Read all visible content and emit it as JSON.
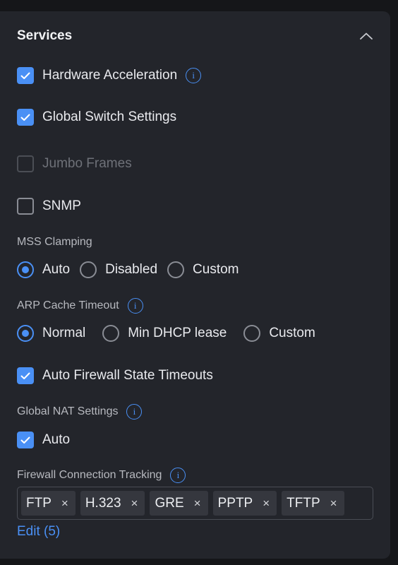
{
  "section": {
    "title": "Services"
  },
  "hardware_acceleration": {
    "label": "Hardware Acceleration"
  },
  "global_switch": {
    "label": "Global Switch Settings"
  },
  "jumbo_frames": {
    "label": "Jumbo Frames"
  },
  "snmp": {
    "label": "SNMP"
  },
  "mss_clamping": {
    "label": "MSS Clamping",
    "options": [
      "Auto",
      "Disabled",
      "Custom"
    ],
    "selected": "Auto"
  },
  "arp_cache": {
    "label": "ARP Cache Timeout",
    "options": [
      "Normal",
      "Min DHCP lease",
      "Custom"
    ],
    "selected": "Normal"
  },
  "auto_firewall": {
    "label": "Auto Firewall State Timeouts"
  },
  "global_nat": {
    "label": "Global NAT Settings",
    "auto_label": "Auto"
  },
  "firewall_tracking": {
    "label": "Firewall Connection Tracking",
    "tags": [
      "FTP",
      "H.323",
      "GRE",
      "PPTP",
      "TFTP"
    ],
    "remove_glyph": "×",
    "edit_link": "Edit (5)"
  },
  "icons": {
    "info_glyph": "i"
  },
  "colors": {
    "accent": "#4a90f5",
    "panel": "#23252b",
    "background": "#151619"
  }
}
